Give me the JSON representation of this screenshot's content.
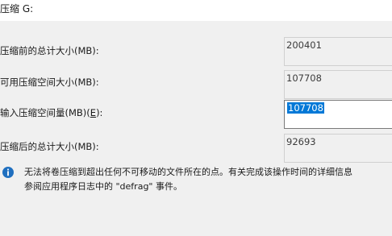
{
  "dialog": {
    "title": "压缩 G:"
  },
  "fields": [
    {
      "label_prefix": "压缩前的总计大小(MB):",
      "label_key": "",
      "label_suffix": "",
      "value": "200401"
    },
    {
      "label_prefix": "可用压缩空间大小(MB):",
      "label_key": "",
      "label_suffix": "",
      "value": "107708"
    },
    {
      "label_prefix": "输入压缩空间量(MB)(",
      "label_key": "E",
      "label_suffix": "):",
      "value": "107708"
    },
    {
      "label_prefix": "压缩后的总计大小(MB):",
      "label_key": "",
      "label_suffix": "",
      "value": "92693"
    }
  ],
  "info": {
    "icon": "info-icon",
    "line1": "无法将卷压缩到超出任何不可移动的文件所在的点。有关完成该操作时间的详细信息",
    "line2": "参阅应用程序日志中的 \"defrag\" 事件。"
  },
  "colors": {
    "info_icon": "#1f6fbf",
    "selection": "#0078d7"
  }
}
